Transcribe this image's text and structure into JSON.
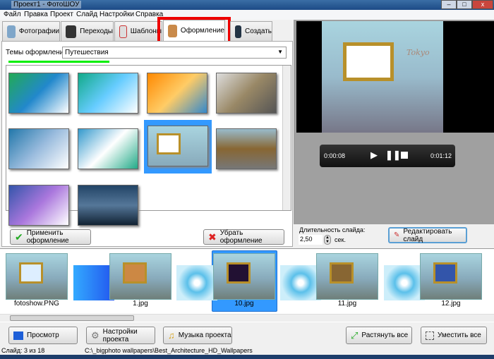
{
  "window": {
    "title": "Проект1 - ФотоШОУ",
    "min": "–",
    "max": "□",
    "close": "x"
  },
  "menu": [
    "Файл",
    "Правка",
    "Проект",
    "Слайд",
    "Настройки",
    "Справка"
  ],
  "tabs": [
    "Фотографии",
    "Переходы",
    "Шаблоны",
    "Оформление",
    "Создать"
  ],
  "themes": {
    "label": "Темы оформлений:",
    "value": "Путешествия",
    "selected_index": 6,
    "count": 10
  },
  "buttons": {
    "apply": "Применить оформление",
    "remove": "Убрать оформление",
    "edit": "Редактировать слайд",
    "preview": "Просмотр",
    "settings": "Настройки проекта",
    "music": "Музыка проекта",
    "stretch": "Растянуть все",
    "fit": "Уместить все"
  },
  "player": {
    "current": "0:00:08",
    "total": "0:01:12",
    "preview_text": "Tokyo"
  },
  "duration": {
    "label": "Длительность слайда:",
    "value": "2,50",
    "unit": "сек."
  },
  "filmstrip": [
    {
      "name": "fotoshow.PNG"
    },
    {
      "name": "1.jpg"
    },
    {
      "name": "10.jpg",
      "selected": true
    },
    {
      "name": "11.jpg"
    },
    {
      "name": "12.jpg"
    }
  ],
  "status": {
    "slide": "Слайд: 3 из 18",
    "path": "C:\\_bigphoto wallpapers\\Best_Architecture_HD_Wallpapers"
  },
  "colors": {
    "accent": "#3399ff",
    "highlight": "#ff0000",
    "underline": "#00ee00"
  }
}
